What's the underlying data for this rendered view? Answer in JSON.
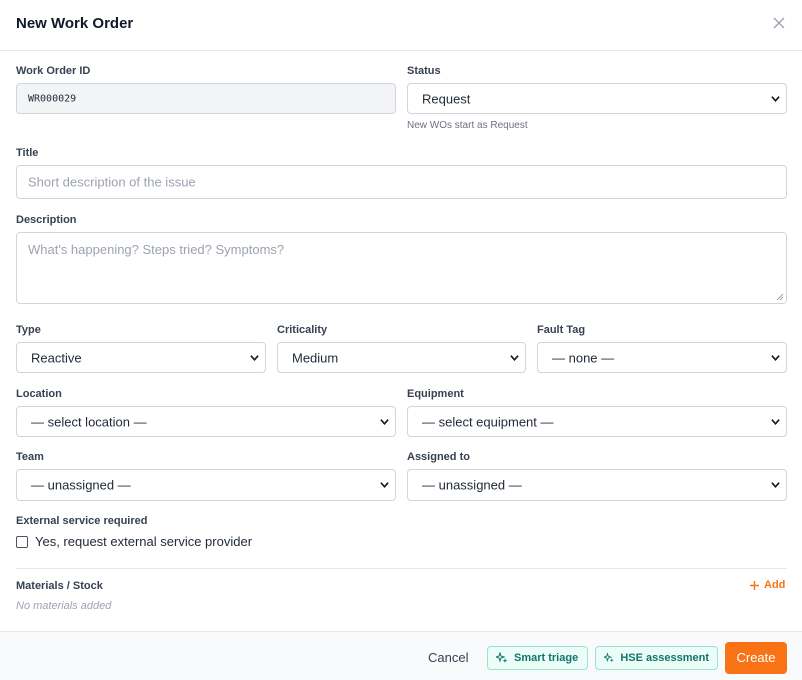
{
  "dialog": {
    "title": "New Work Order",
    "close_icon": "close-icon"
  },
  "fields": {
    "work_order_id": {
      "label": "Work Order ID",
      "value": "WR000029"
    },
    "status": {
      "label": "Status",
      "value": "Request",
      "hint": "New WOs start as Request"
    },
    "title": {
      "label": "Title",
      "placeholder": "Short description of the issue"
    },
    "description": {
      "label": "Description",
      "placeholder": "What's happening? Steps tried? Symptoms?"
    },
    "type": {
      "label": "Type",
      "value": "Reactive"
    },
    "criticality": {
      "label": "Criticality",
      "value": "Medium"
    },
    "fault_tag": {
      "label": "Fault Tag",
      "value": "— none —"
    },
    "location": {
      "label": "Location",
      "value": "— select location —"
    },
    "equipment": {
      "label": "Equipment",
      "value": "— select equipment —"
    },
    "team": {
      "label": "Team",
      "value": "— unassigned —"
    },
    "assigned_to": {
      "label": "Assigned to",
      "value": "— unassigned —"
    },
    "external_service": {
      "label": "External service required",
      "checkbox_label": "Yes, request external service provider",
      "checked": false
    }
  },
  "materials": {
    "label": "Materials / Stock",
    "add_label": "Add",
    "empty_text": "No materials added"
  },
  "footer": {
    "cancel_label": "Cancel",
    "smart_triage_label": "Smart triage",
    "hse_label": "HSE assessment",
    "create_label": "Create"
  },
  "colors": {
    "accent": "#f97316",
    "ai_button_bg": "#ecfdf7",
    "ai_button_text": "#0f766e"
  }
}
